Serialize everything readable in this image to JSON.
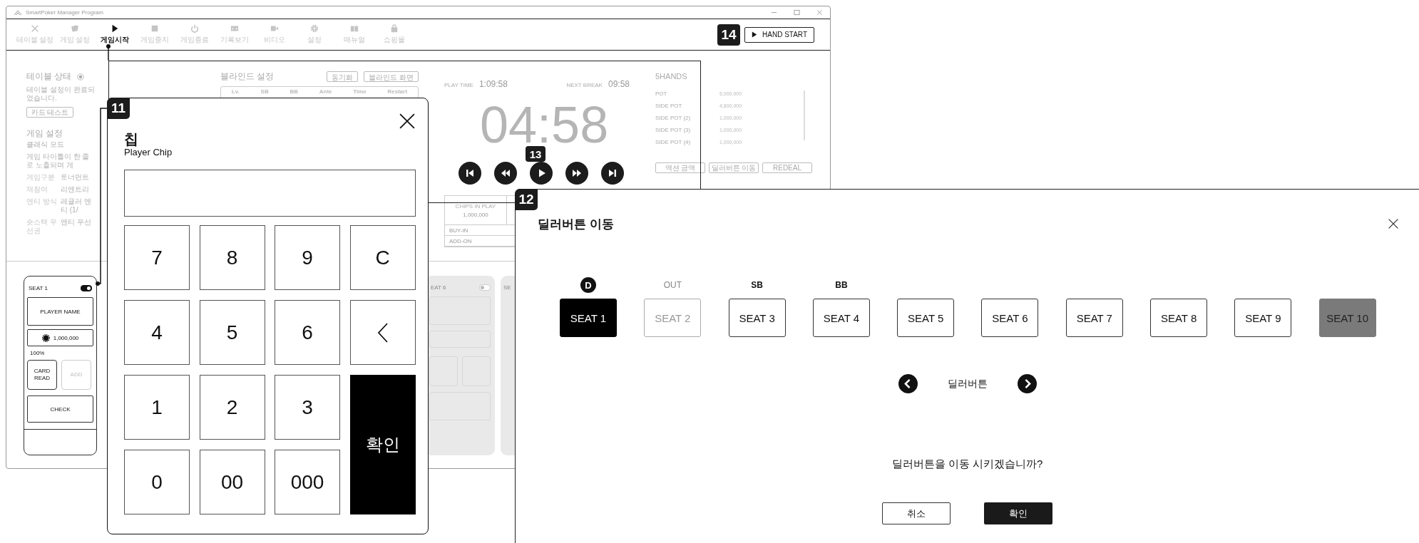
{
  "window": {
    "title": "SmartPoker Manager Program"
  },
  "toolbar": {
    "items": [
      {
        "label": "테이블 설정",
        "kind": "tools",
        "selected": false
      },
      {
        "label": "게임 설정",
        "kind": "cards",
        "selected": false
      },
      {
        "label": "게임시작",
        "kind": "play",
        "selected": true
      },
      {
        "label": "게임중지",
        "kind": "stop",
        "selected": false
      },
      {
        "label": "게임종료",
        "kind": "power",
        "selected": false
      },
      {
        "label": "기록보기",
        "kind": "record",
        "selected": false
      },
      {
        "label": "비디오",
        "kind": "video",
        "selected": false
      },
      {
        "label": "설정",
        "kind": "settings",
        "selected": false
      },
      {
        "label": "매뉴얼",
        "kind": "manual",
        "selected": false
      },
      {
        "label": "쇼핑몰",
        "kind": "shop",
        "selected": false
      }
    ],
    "callout": "14",
    "hand_start": "HAND START"
  },
  "table_status": {
    "title": "테이블 상태",
    "checked": true,
    "message": "테이블 설정이 완료되었습니다.",
    "card_test": "카드 테스트"
  },
  "game_settings": {
    "title": "게임 설정",
    "mode": "클래식 모드",
    "description": "게임 타이틀이 한 줄로 노출되며 게",
    "rows": [
      {
        "label": "게임구분",
        "value": "토너먼트"
      },
      {
        "label": "재참여",
        "value": "리엔트리"
      },
      {
        "label": "엔티 방식",
        "value": "레귤러 엔티 (1/"
      },
      {
        "label": "숏스택 우선권",
        "value": "엔티 우선"
      }
    ]
  },
  "blinds": {
    "title": "블라인드 설정",
    "buttons": [
      "동기화",
      "블라인드 화면"
    ],
    "columns": [
      "Lv.",
      "SB",
      "BB",
      "Ante",
      "Time",
      "Restart"
    ]
  },
  "timer": {
    "play_time_label": "PLAY TIME",
    "play_time": "1:09:58",
    "next_break_label": "NEXT BREAK",
    "next_break": "09:58",
    "clock": "04:58",
    "callout": "13",
    "controls": [
      {
        "kind": "first"
      },
      {
        "kind": "rewind"
      },
      {
        "kind": "play"
      },
      {
        "kind": "forward"
      },
      {
        "kind": "last"
      }
    ]
  },
  "chips": {
    "label": "CHIPS IN PLAY",
    "value": "1,000,000",
    "rows": [
      "BUY-IN",
      "ADD-ON"
    ]
  },
  "hands": {
    "title": "5HANDS",
    "pots": [
      {
        "label": "POT",
        "value": "5,000,000"
      },
      {
        "label": "SIDE POT",
        "value": "4,800,000"
      },
      {
        "label": "SIDE POT (2)",
        "value": "1,000,000"
      },
      {
        "label": "SIDE POT (3)",
        "value": "1,000,000"
      },
      {
        "label": "SIDE POT (4)",
        "value": "1,000,000"
      }
    ],
    "buttons": [
      "액션 금액",
      "딜러버튼 이동",
      "REDEAL"
    ]
  },
  "seats": [
    {
      "kind": "active",
      "label": "SEAT 1",
      "on": true,
      "player": "PLAYER NAME",
      "chips": "1,000,000",
      "percent": "100%",
      "card_read": "CARD READ",
      "add": "ADD",
      "check": "CHECK"
    },
    {
      "kind": "inactive",
      "label": "EAT 6",
      "on": false,
      "placeholders": true
    },
    {
      "kind": "inactive",
      "label": "SE"
    }
  ],
  "numpad": {
    "callout": "11",
    "title": "칩",
    "subtitle": "Player Chip",
    "keys": [
      {
        "kind": "digit",
        "label": "7"
      },
      {
        "kind": "digit",
        "label": "8"
      },
      {
        "kind": "digit",
        "label": "9"
      },
      {
        "kind": "clear",
        "label": "C"
      },
      {
        "kind": "digit",
        "label": "4"
      },
      {
        "kind": "digit",
        "label": "5"
      },
      {
        "kind": "digit",
        "label": "6"
      },
      {
        "kind": "back"
      },
      {
        "kind": "digit",
        "label": "1"
      },
      {
        "kind": "digit",
        "label": "2"
      },
      {
        "kind": "digit",
        "label": "3"
      },
      {
        "kind": "confirm",
        "label": "확인"
      },
      {
        "kind": "digit",
        "label": "0"
      },
      {
        "kind": "digit",
        "label": "00"
      },
      {
        "kind": "digit",
        "label": "000"
      }
    ]
  },
  "dealer": {
    "callout": "12",
    "title": "딜러버튼 이동",
    "seats": [
      {
        "label": "SEAT 1",
        "tag": {
          "kind": "dealer",
          "text": "D"
        },
        "selected": true,
        "disabled": false,
        "inactive": false
      },
      {
        "label": "SEAT 2",
        "tag": {
          "kind": "muted",
          "text": "OUT"
        },
        "selected": false,
        "disabled": true,
        "inactive": false
      },
      {
        "label": "SEAT 3",
        "tag": {
          "kind": "strong",
          "text": "SB"
        },
        "selected": false,
        "disabled": false,
        "inactive": false
      },
      {
        "label": "SEAT 4",
        "tag": {
          "kind": "strong",
          "text": "BB"
        },
        "selected": false,
        "disabled": false,
        "inactive": false
      },
      {
        "label": "SEAT 5",
        "selected": false,
        "disabled": false,
        "inactive": false
      },
      {
        "label": "SEAT 6",
        "selected": false,
        "disabled": false,
        "inactive": false
      },
      {
        "label": "SEAT 7",
        "selected": false,
        "disabled": false,
        "inactive": false
      },
      {
        "label": "SEAT 8",
        "selected": false,
        "disabled": false,
        "inactive": false
      },
      {
        "label": "SEAT 9",
        "selected": false,
        "disabled": false,
        "inactive": false
      },
      {
        "label": "SEAT 10",
        "selected": false,
        "disabled": false,
        "inactive": true
      }
    ],
    "nav_label": "딜러버튼",
    "question": "딜러버튼을 이동 시키겠습니까?",
    "cancel": "취소",
    "confirm": "확인"
  }
}
